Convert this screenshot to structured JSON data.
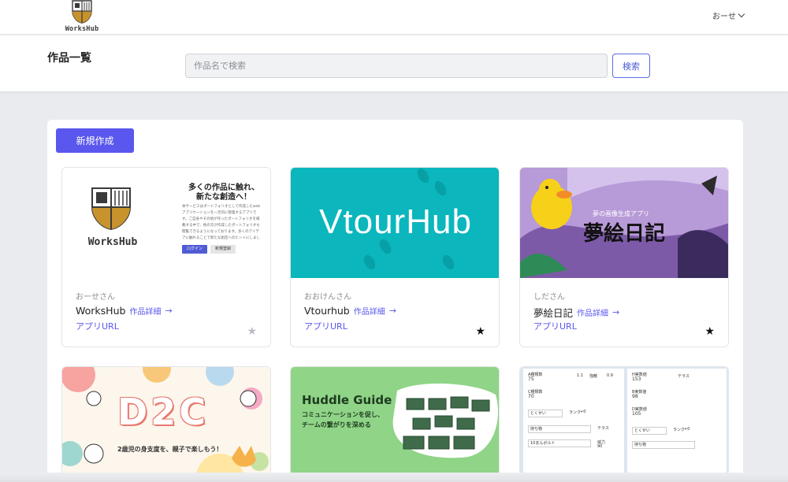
{
  "nav": {
    "logo_text": "WorksHub",
    "user_name": "おーせ"
  },
  "header": {
    "title": "作品一覧",
    "search_placeholder": "作品名で検索",
    "search_button": "検索"
  },
  "actions": {
    "new_button": "新規作成"
  },
  "cards": [
    {
      "author": "おーせさん",
      "title": "WorksHub",
      "detail_link": "作品詳細",
      "url_link": "アプリURL",
      "favorited": false,
      "thumb": {
        "logo_text": "WorksHub",
        "headline_1": "多くの作品に触れ、",
        "headline_2": "新たな創造へ！",
        "body": "本サービスはポートフォリオとして作成したwebアプリケーションを一元的に管理するアプリです。ご自身やその他が作ったポートフォリオを掲載する中で、他の方が作成したポートフォリオも閲覧できるようになっております。多くのアイデアに触れることで新たな創造へのヒントにしましょう！",
        "btn_login": "ログイン",
        "btn_signup": "新規登録"
      }
    },
    {
      "author": "おおけんさん",
      "title": "Vtourhub",
      "detail_link": "作品詳細",
      "url_link": "アプリURL",
      "favorited": true,
      "thumb": {
        "text": "VtourHub"
      }
    },
    {
      "author": "しださん",
      "title": "夢絵日記",
      "detail_link": "作品詳細",
      "url_link": "アプリURL",
      "favorited": true,
      "thumb": {
        "subtitle": "夢の画像生成アプリ",
        "text": "夢絵日記"
      }
    }
  ],
  "cards_row2": [
    {
      "thumb": {
        "text": "D2C",
        "caption": "2歳児の身支度を、親子で楽しもう！"
      }
    },
    {
      "thumb": {
        "title": "Huddle Guide",
        "line1": "コミュニケーションを促し、",
        "line2": "チームの繋がりを深める"
      }
    },
    {
      "thumb": {
        "label_a": "A種類数",
        "val_a": "75",
        "label_b": "C種類数",
        "val_b": "70",
        "n_11": "1.1",
        "w_ryo": "強敵",
        "n_09": "0.9",
        "rank_label": "ランク",
        "rank_value": "+0",
        "tokusei": "とくせい",
        "mochimono": "持ち物",
        "toggle_label": "テラス",
        "item_name": "10まんボルト",
        "power_label": "威力",
        "power_value": "90",
        "label_h": "H実数値",
        "val_h": "153",
        "label_b2": "B実数値",
        "val_b2": "98",
        "label_d": "D実数値",
        "val_d": "105",
        "terasu": "テラス"
      }
    }
  ]
}
